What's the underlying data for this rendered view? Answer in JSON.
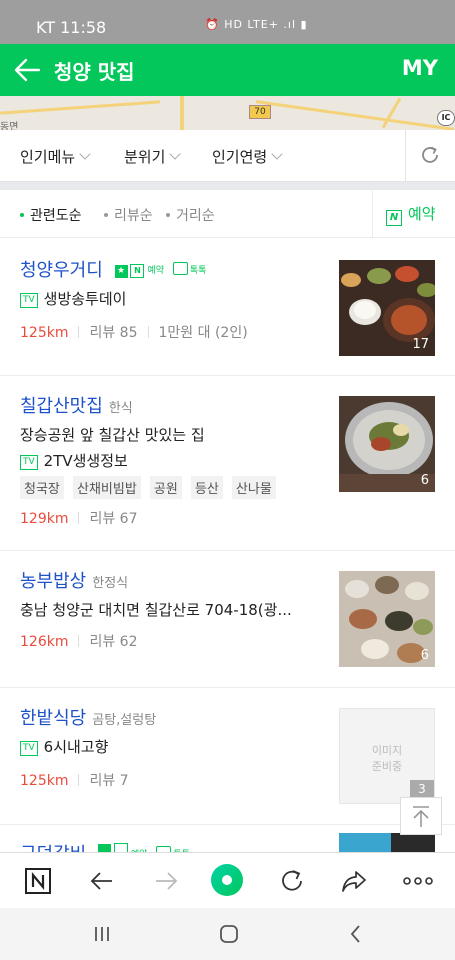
{
  "status_bar": {
    "carrier_time": "KT 11:58",
    "icons_text": "⏰ HD LTE+ .ıl ▮"
  },
  "header": {
    "title": "청양 맛집",
    "my_label": "MY"
  },
  "map": {
    "left_label": "동면",
    "road_number": "70",
    "ic_label": "IC"
  },
  "filters": [
    {
      "label": "인기메뉴"
    },
    {
      "label": "분위기"
    },
    {
      "label": "인기연령"
    }
  ],
  "sort": {
    "options": [
      {
        "label": "관련도순",
        "active": true
      },
      {
        "label": "리뷰순",
        "active": false
      },
      {
        "label": "거리순",
        "active": false
      }
    ],
    "reservation_label": "예약",
    "n_icon": "N"
  },
  "places": [
    {
      "name": "청양우거디",
      "category": "",
      "badges": {
        "star": "★",
        "n": "N",
        "reserve": "예약",
        "talk": "톡톡"
      },
      "tv_label": "TV",
      "tv_show": "생방송투데이",
      "distance": "125km",
      "reviews": "리뷰 85",
      "price": "1만원 대 (2인)",
      "photo_count": "17"
    },
    {
      "name": "칠갑산맛집",
      "category": "한식",
      "description": "장승공원 앞 칠갑산 맛있는 집",
      "tv_label": "TV",
      "tv_show": "2TV생생정보",
      "tags": [
        "청국장",
        "산채비빔밥",
        "공원",
        "등산",
        "산나물"
      ],
      "distance": "129km",
      "reviews": "리뷰 67",
      "photo_count": "6"
    },
    {
      "name": "농부밥상",
      "category": "한정식",
      "address": "충남 청양군 대치면 칠갑산로 704-18(광...",
      "distance": "126km",
      "reviews": "리뷰 62",
      "photo_count": "6"
    },
    {
      "name": "한밭식당",
      "category": "곰탕,설렁탕",
      "tv_label": "TV",
      "tv_show": "6시내고향",
      "distance": "125km",
      "reviews": "리뷰 7",
      "placeholder_line1": "이미지",
      "placeholder_line2": "준비중"
    },
    {
      "name": "구덕갈비",
      "badges": {
        "reserve": "예약",
        "talk": "톡톡"
      }
    }
  ],
  "floating": {
    "page_number": "3"
  },
  "colors": {
    "brand": "#03c75a",
    "link": "#1e52c9",
    "distance": "#e84c3d"
  }
}
